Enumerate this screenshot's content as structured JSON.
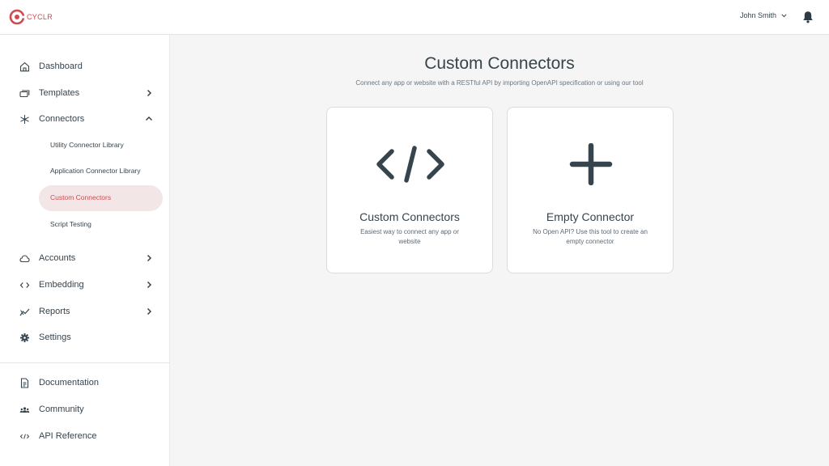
{
  "header": {
    "logo_text": "CYCLR",
    "user_name": "John Smith",
    "brand_color": "#d14a4f"
  },
  "sidebar": {
    "items": [
      {
        "label": "Dashboard",
        "icon": "home-icon"
      },
      {
        "label": "Templates",
        "icon": "templates-icon"
      },
      {
        "label": "Connectors",
        "icon": "connectors-icon"
      },
      {
        "label": "Accounts",
        "icon": "cloud-icon"
      },
      {
        "label": "Embedding",
        "icon": "code-icon"
      },
      {
        "label": "Reports",
        "icon": "reports-icon"
      },
      {
        "label": "Settings",
        "icon": "gear-icon"
      }
    ],
    "connector_subitems": [
      {
        "label": "Utility Connector Library"
      },
      {
        "label": "Application Connector Library"
      },
      {
        "label": "Custom Connectors",
        "active": true
      },
      {
        "label": "Script Testing"
      }
    ],
    "footer_items": [
      {
        "label": "Documentation",
        "icon": "document-icon"
      },
      {
        "label": "Community",
        "icon": "community-icon"
      },
      {
        "label": "API Reference",
        "icon": "code-icon"
      }
    ]
  },
  "main": {
    "title": "Custom Connectors",
    "subtitle": "Connect any app or website with a RESTful API by importing OpenAPI specification or using our tool",
    "cards": [
      {
        "title": "Custom Connectors",
        "description": "Easiest way to connect any app or website",
        "icon": "code-brackets-icon"
      },
      {
        "title": "Empty Connector",
        "description": "No Open API? Use this tool to create an empty connector",
        "icon": "plus-icon"
      }
    ]
  }
}
